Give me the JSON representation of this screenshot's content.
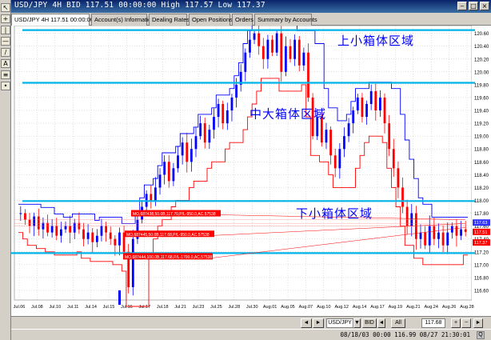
{
  "window": {
    "title": "USD/JPY 4H BID 117.51 00:00:00 High 117.57 Low 117.37",
    "minimize_glyph": "‒",
    "restore_glyph": "□",
    "close_glyph": "×"
  },
  "left_toolbar": {
    "items": [
      {
        "icon": "cursor-icon",
        "glyph": "↖"
      },
      {
        "icon": "crosshair-icon",
        "glyph": "+"
      },
      {
        "icon": "vertical-line-icon",
        "glyph": "|"
      },
      {
        "icon": "horizontal-line-icon",
        "glyph": "—"
      },
      {
        "icon": "trend-line-icon",
        "glyph": "/"
      },
      {
        "icon": "text-icon",
        "glyph": "A"
      },
      {
        "icon": "fibonacci-icon",
        "glyph": "≡"
      },
      {
        "icon": "dot-icon",
        "glyph": "•"
      }
    ]
  },
  "tabs": [
    {
      "label": "USD/JPY 4H 117.51 00:00:00",
      "active": true
    },
    {
      "label": "Account(s) Information",
      "active": false
    },
    {
      "label": "Dealing Rates",
      "active": false
    },
    {
      "label": "Open Positions",
      "active": false
    },
    {
      "label": "Orders",
      "active": false
    },
    {
      "label": "Summary by Accounts",
      "active": false
    }
  ],
  "annotations": {
    "upper_box": "上小箱体区域",
    "middle_box": "中大箱体区域",
    "lower_box": "下小箱体区域"
  },
  "orders": [
    {
      "text": "MO,687438,50.0B,117.70,P/L-950.0,AC.57538"
    },
    {
      "text": "MO,687445,50.0B,117.68,P/L-950.0,AC.57538"
    },
    {
      "text": "MO,687444,100.0B,117.68,P/L-1700.0,AC.57538"
    }
  ],
  "price_tags": {
    "ask": "117.63",
    "bid": "117.51",
    "low": "117.37"
  },
  "symbol_bar": {
    "nav_prev": "◄",
    "nav_next": "►",
    "symbol": "USD/JPY",
    "dropdown": "▼",
    "side": "BID",
    "side_toggle": "◄",
    "range": "All",
    "price": "117.68",
    "zoom_in": "+",
    "zoom_out": "−",
    "scroll": "►"
  },
  "status": {
    "text": "08/18/03 00:00  116.99 08/27 21:30:01",
    "icon": "Q"
  },
  "colors": {
    "candle_up": "#0000ff",
    "candle_down": "#ff0000",
    "upper_band": "#0000ff",
    "lower_band": "#ff0000",
    "zone_line": "#00b4e8",
    "order_tag": "#ff0000",
    "annotation": "#0000ff"
  },
  "chart_data": {
    "type": "candlestick",
    "symbol": "USD/JPY",
    "timeframe": "4H",
    "y_ticks": [
      "120.60",
      "120.40",
      "120.20",
      "120.00",
      "119.80",
      "119.60",
      "119.40",
      "119.20",
      "119.00",
      "118.80",
      "118.60",
      "118.40",
      "118.20",
      "118.00",
      "117.80",
      "117.60",
      "117.40",
      "117.20",
      "117.00",
      "116.80",
      "116.60"
    ],
    "ylim": [
      116.45,
      120.72
    ],
    "x_labels": [
      "Jul.06",
      "Jul.08",
      "Jul.10",
      "Jul.11",
      "Jul.14",
      "Jul.15",
      "Jul.16",
      "Jul.17",
      "Jul.18",
      "Jul.21",
      "Jul.23",
      "Jul.25",
      "Jul.28",
      "Jul.30",
      "Aug.01",
      "Aug.05",
      "Aug.07",
      "Aug.10",
      "Aug.12",
      "Aug.14",
      "Aug.17",
      "Aug.19",
      "Aug.21",
      "Aug.24",
      "Aug.26",
      "Aug.28"
    ],
    "zone_levels": [
      120.65,
      119.83,
      117.99,
      117.18
    ],
    "order_prices": [
      117.7,
      117.68,
      117.68
    ],
    "close_path": [
      117.8,
      117.7,
      117.6,
      117.75,
      117.55,
      117.65,
      117.5,
      117.6,
      117.45,
      117.55,
      117.6,
      117.5,
      117.65,
      117.55,
      117.4,
      117.5,
      117.35,
      117.45,
      117.6,
      117.5,
      117.4,
      117.3,
      117.5,
      117.2,
      116.65,
      117.4,
      117.7,
      117.9,
      118.1,
      118.0,
      118.2,
      118.4,
      118.6,
      118.3,
      118.5,
      118.7,
      118.9,
      118.6,
      118.8,
      119.0,
      119.2,
      118.9,
      119.1,
      119.3,
      119.5,
      119.2,
      119.4,
      119.6,
      119.8,
      120.0,
      120.3,
      120.5,
      120.6,
      120.4,
      120.2,
      120.5,
      120.3,
      120.6,
      120.0,
      120.4,
      120.2,
      120.5,
      120.1,
      120.3,
      119.6,
      119.0,
      119.3,
      118.9,
      119.1,
      118.7,
      118.5,
      118.8,
      119.0,
      119.2,
      119.4,
      119.6,
      119.3,
      119.5,
      119.7,
      119.4,
      119.6,
      119.2,
      118.8,
      118.5,
      118.2,
      117.9,
      117.6,
      117.8,
      117.4,
      117.5,
      117.3,
      117.6,
      117.4,
      117.5,
      117.3,
      117.5,
      117.6,
      117.45,
      117.55,
      117.51
    ]
  }
}
